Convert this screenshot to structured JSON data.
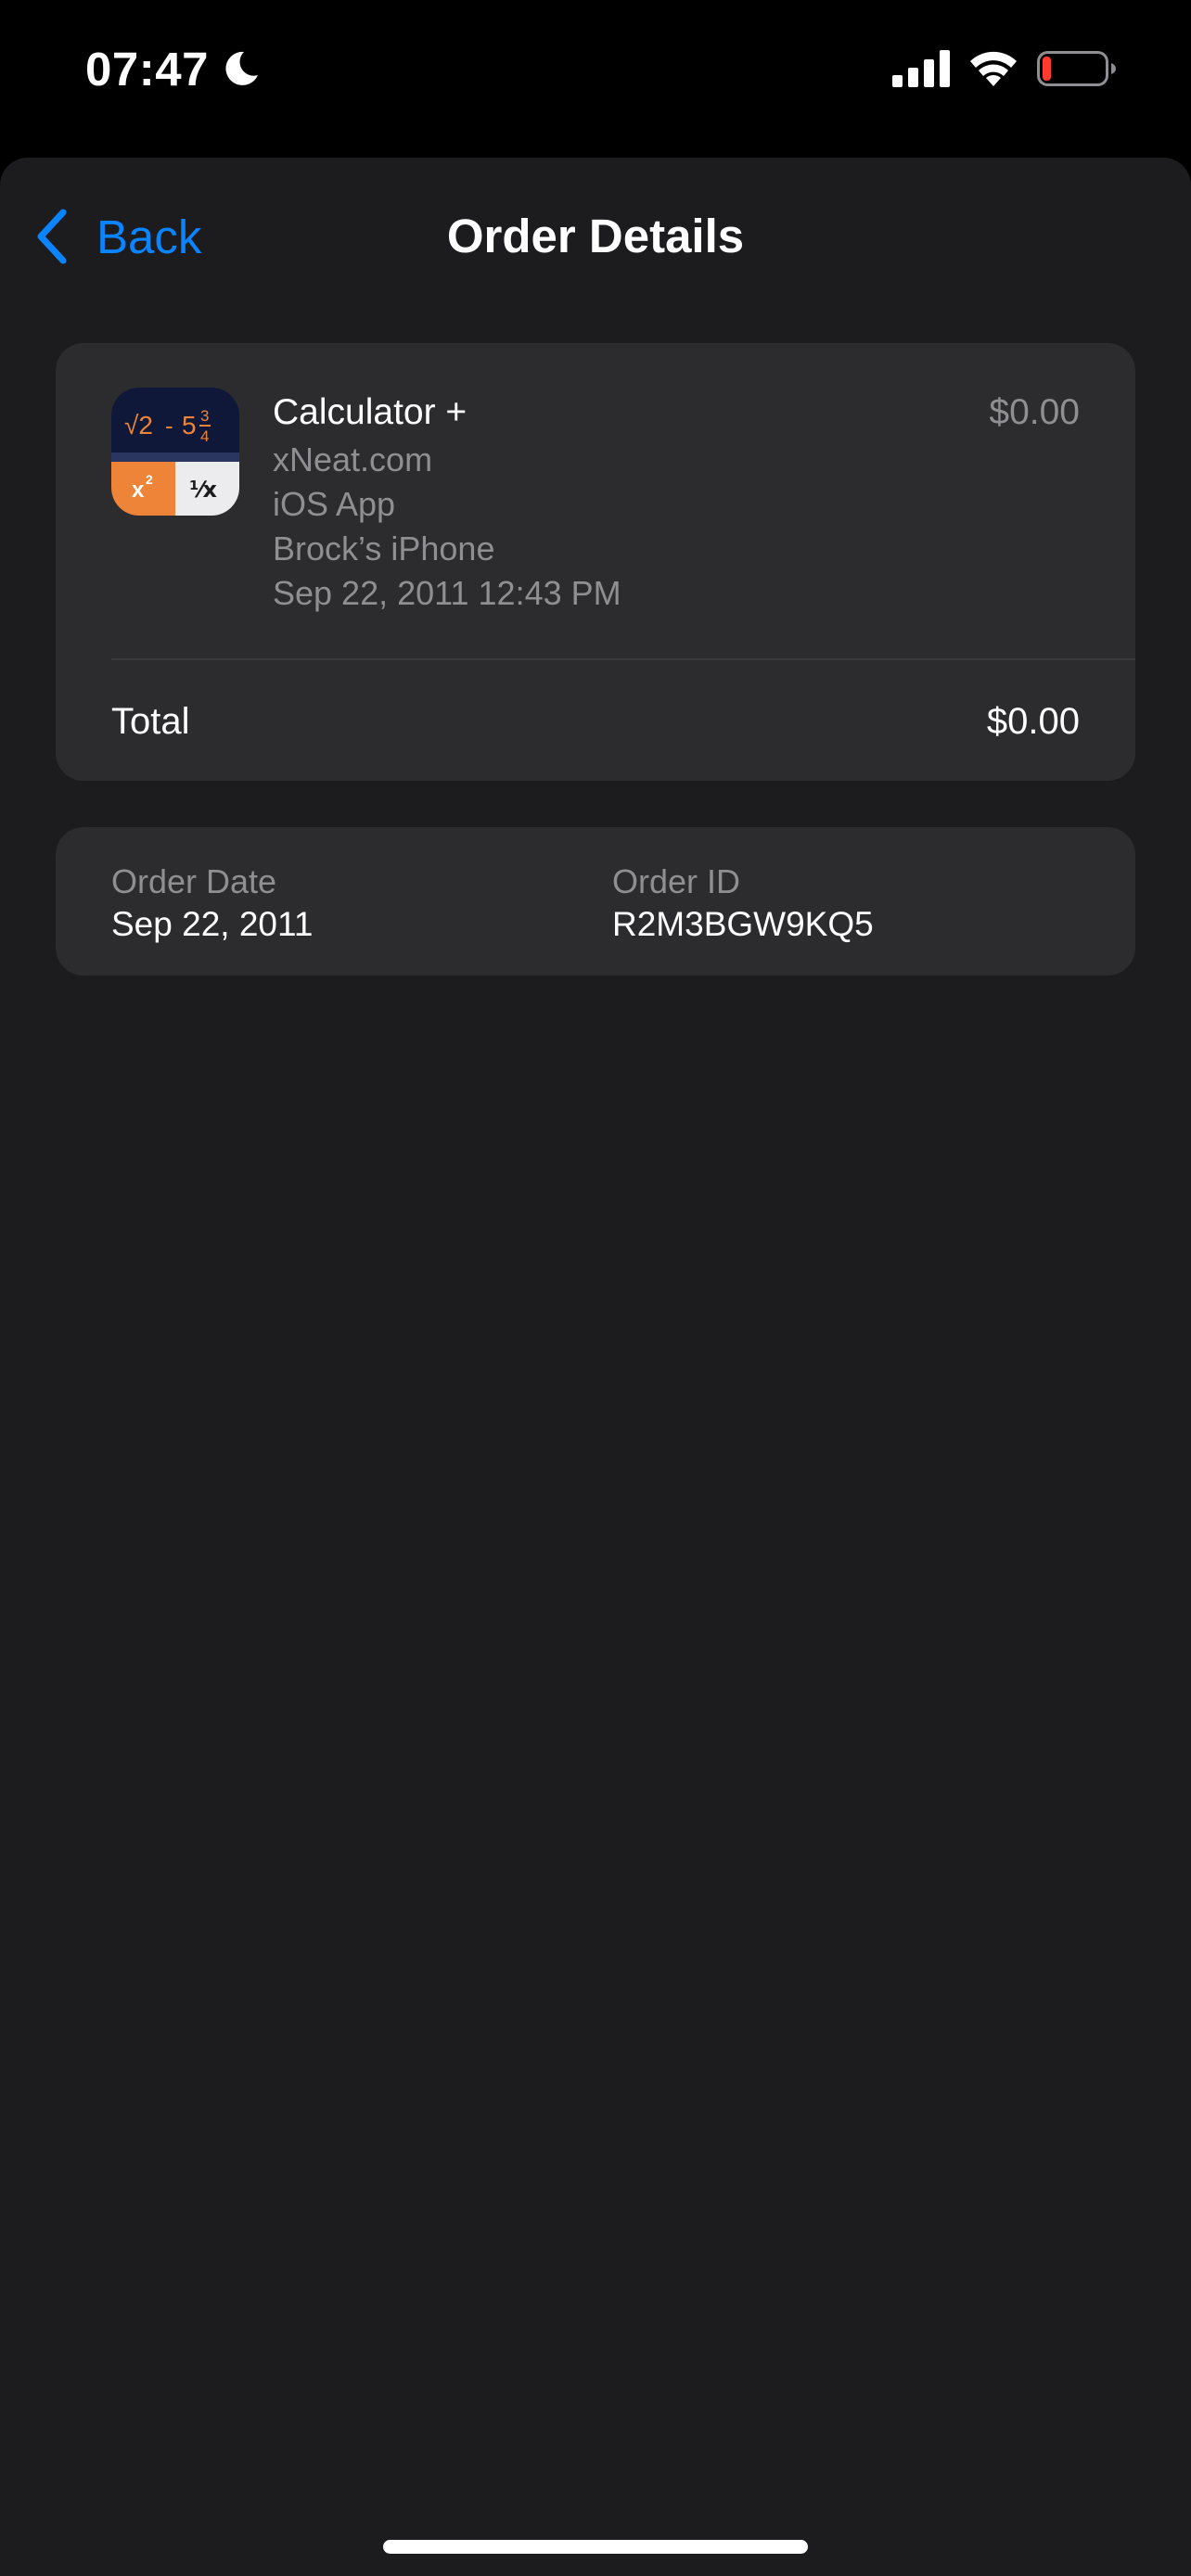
{
  "status_bar": {
    "time": "07:47",
    "moon_icon": "moon-icon",
    "signal_icon": "cellular-signal-icon",
    "wifi_icon": "wifi-icon",
    "battery_icon": "battery-low-icon",
    "battery_level": 0.1,
    "battery_color": "#ff3b30"
  },
  "nav": {
    "back_label": "Back",
    "title": "Order Details",
    "accent_color": "#0a84ff"
  },
  "item": {
    "icon": "calculator-app-icon",
    "name": "Calculator +",
    "developer": "xNeat.com",
    "type": "iOS App",
    "device": "Brock’s iPhone",
    "purchase_datetime": "Sep 22, 2011 12:43 PM",
    "price": "$0.00",
    "icon_text": {
      "sqrt": "√2",
      "minus": "-",
      "whole": "5",
      "numerator": "3",
      "denominator": "4",
      "square": "x",
      "square_exp": "2",
      "reciprocal": "¹⁄x"
    }
  },
  "total": {
    "label": "Total",
    "value": "$0.00"
  },
  "order": {
    "date_label": "Order Date",
    "date_value": "Sep 22, 2011",
    "id_label": "Order ID",
    "id_value": "R2M3BGW9KQ5"
  }
}
